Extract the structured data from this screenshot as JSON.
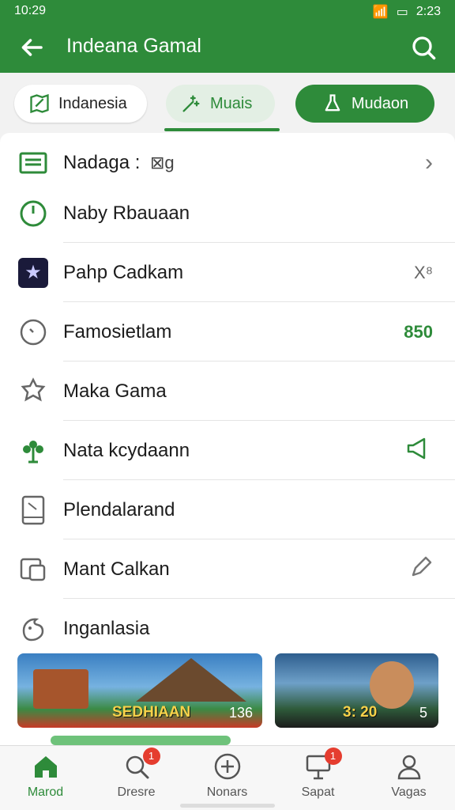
{
  "status_bar": {
    "time_left": "10:29",
    "time_right": "2:23"
  },
  "app_bar": {
    "title": "Indeana Gamal"
  },
  "chips": [
    {
      "label": "Indanesia"
    },
    {
      "label": "Muais"
    },
    {
      "label": "Mudaon"
    }
  ],
  "list": [
    {
      "label": "Nadaga :",
      "trailing": "›",
      "extra": "⊠g"
    },
    {
      "label": "Naby Rbauaan",
      "trailing": ""
    },
    {
      "label": "Pahp Cadkam",
      "trailing": "X⁸"
    },
    {
      "label": "Famosietlam",
      "trailing": "850"
    },
    {
      "label": "Maka Gama",
      "trailing": ""
    },
    {
      "label": "Nata kcydaann",
      "trailing": ""
    },
    {
      "label": "Plendalarand",
      "trailing": ""
    },
    {
      "label": "Mant Calkan",
      "trailing": ""
    },
    {
      "label": "Inganlasia",
      "trailing": ""
    }
  ],
  "banners": [
    {
      "title": "SEDHIAAN",
      "value": "136"
    },
    {
      "title": "3:  20",
      "value": "5"
    }
  ],
  "bottom_nav": [
    {
      "label": "Marod",
      "badge": ""
    },
    {
      "label": "Dresre",
      "badge": "1"
    },
    {
      "label": "Nonars",
      "badge": ""
    },
    {
      "label": "Sapat",
      "badge": "1"
    },
    {
      "label": "Vagas",
      "badge": ""
    }
  ],
  "colors": {
    "brand": "#2e8b3a",
    "badge": "#e53d2f"
  }
}
